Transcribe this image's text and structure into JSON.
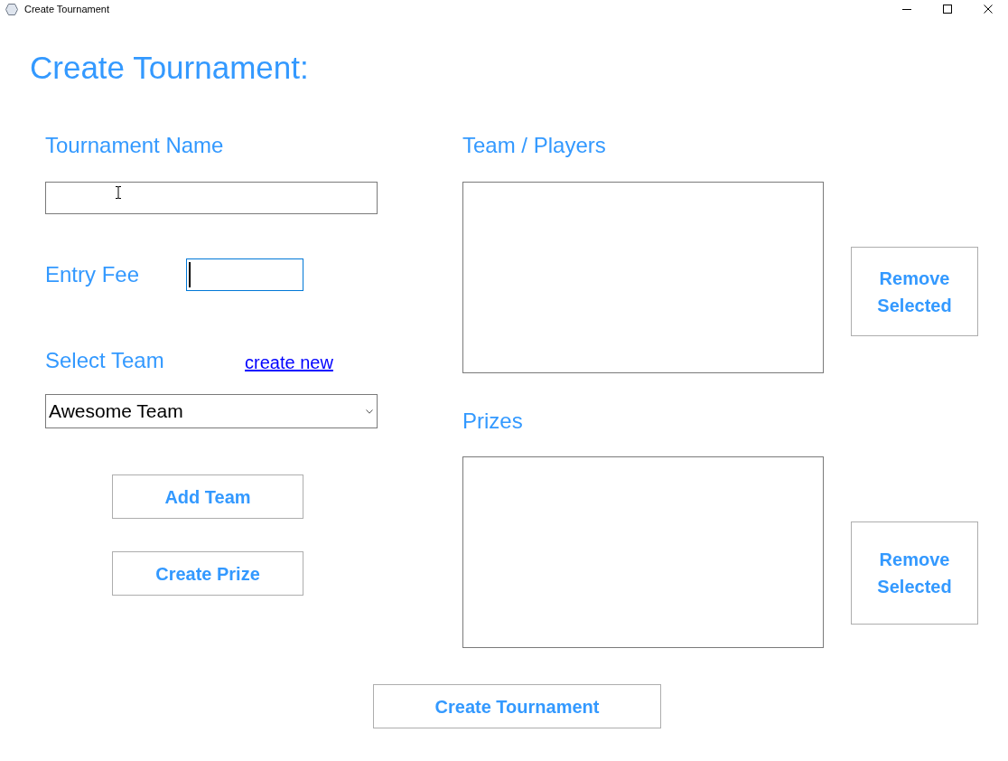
{
  "window": {
    "title": "Create Tournament"
  },
  "heading": "Create Tournament:",
  "tournament_name": {
    "label": "Tournament Name"
  },
  "entry_fee": {
    "label": "Entry Fee",
    "focused": true
  },
  "team_select": {
    "label": "Select Team",
    "link": "create new",
    "value": "Awesome Team"
  },
  "team_buttons": [
    "Add Team",
    "Create Prize"
  ],
  "team_players": {
    "label": "Team / Players",
    "remove_button": "Remove Selected"
  },
  "prizes": {
    "label": "Prizes",
    "remove_button": "Remove Selected"
  },
  "create_button": "Create Tournament"
}
